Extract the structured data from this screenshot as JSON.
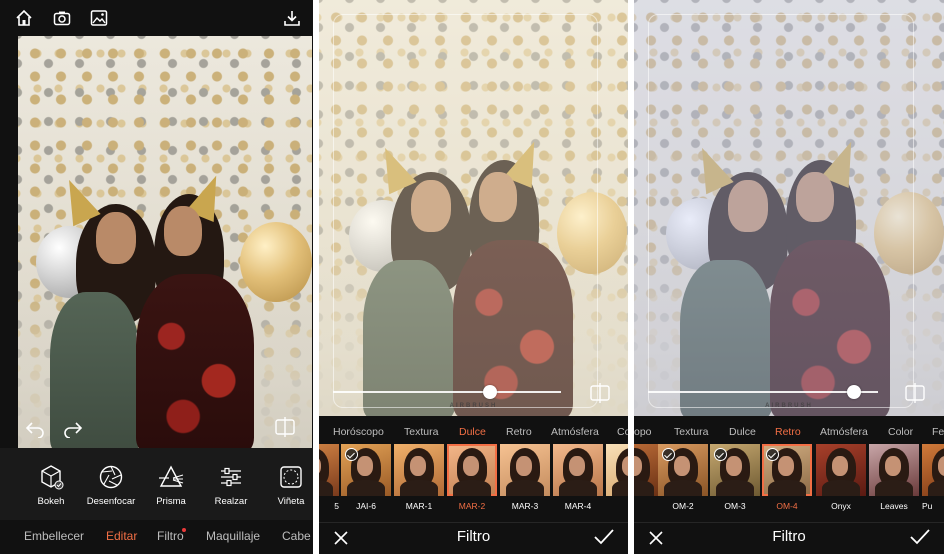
{
  "editor": {
    "topbar": {
      "icons": [
        "home-icon",
        "camera-icon",
        "gallery-icon",
        "download-icon"
      ]
    },
    "tools": [
      {
        "label": "Bokeh",
        "icon": "bokeh-icon"
      },
      {
        "label": "Desenfocar",
        "icon": "aperture-icon"
      },
      {
        "label": "Prisma",
        "icon": "prism-icon"
      },
      {
        "label": "Realzar",
        "icon": "sliders-icon"
      },
      {
        "label": "Viñeta",
        "icon": "vignette-icon"
      }
    ],
    "tabs": [
      {
        "label": "Embellecer",
        "active": false
      },
      {
        "label": "Editar",
        "active": true
      },
      {
        "label": "Filtro",
        "active": false,
        "badge": true
      },
      {
        "label": "Maquillaje",
        "active": false
      },
      {
        "label": "Cabe",
        "active": false
      }
    ],
    "accent_color": "#f26f45"
  },
  "filter_dulce": {
    "title": "Filtro",
    "watermark": "AIRBRUSH",
    "intensity": 0.7,
    "categories": [
      "Horóscopo",
      "Textura",
      "Dulce",
      "Retro",
      "Atmósfera",
      "Co"
    ],
    "active_category": "Dulce",
    "thumbs": [
      {
        "label": "5",
        "checked": false,
        "selected": false
      },
      {
        "label": "JAI-6",
        "checked": true,
        "selected": false
      },
      {
        "label": "MAR-1",
        "checked": false,
        "selected": false
      },
      {
        "label": "MAR-2",
        "checked": false,
        "selected": true
      },
      {
        "label": "MAR-3",
        "checked": false,
        "selected": false
      },
      {
        "label": "MAR-4",
        "checked": false,
        "selected": false
      },
      {
        "label": "",
        "checked": false,
        "selected": false
      }
    ]
  },
  "filter_retro": {
    "title": "Filtro",
    "watermark": "AIRBRUSH",
    "intensity": 0.92,
    "categories": [
      "opo",
      "Textura",
      "Dulce",
      "Retro",
      "Atmósfera",
      "Color",
      "Fe"
    ],
    "active_category": "Retro",
    "thumbs": [
      {
        "label": "",
        "checked": false,
        "selected": false
      },
      {
        "label": "OM-2",
        "checked": true,
        "selected": false
      },
      {
        "label": "OM-3",
        "checked": true,
        "selected": false
      },
      {
        "label": "OM-4",
        "checked": true,
        "selected": true
      },
      {
        "label": "Onyx",
        "checked": false,
        "selected": false
      },
      {
        "label": "Leaves",
        "checked": false,
        "selected": false
      },
      {
        "label": "Pu",
        "checked": false,
        "selected": false
      }
    ]
  }
}
